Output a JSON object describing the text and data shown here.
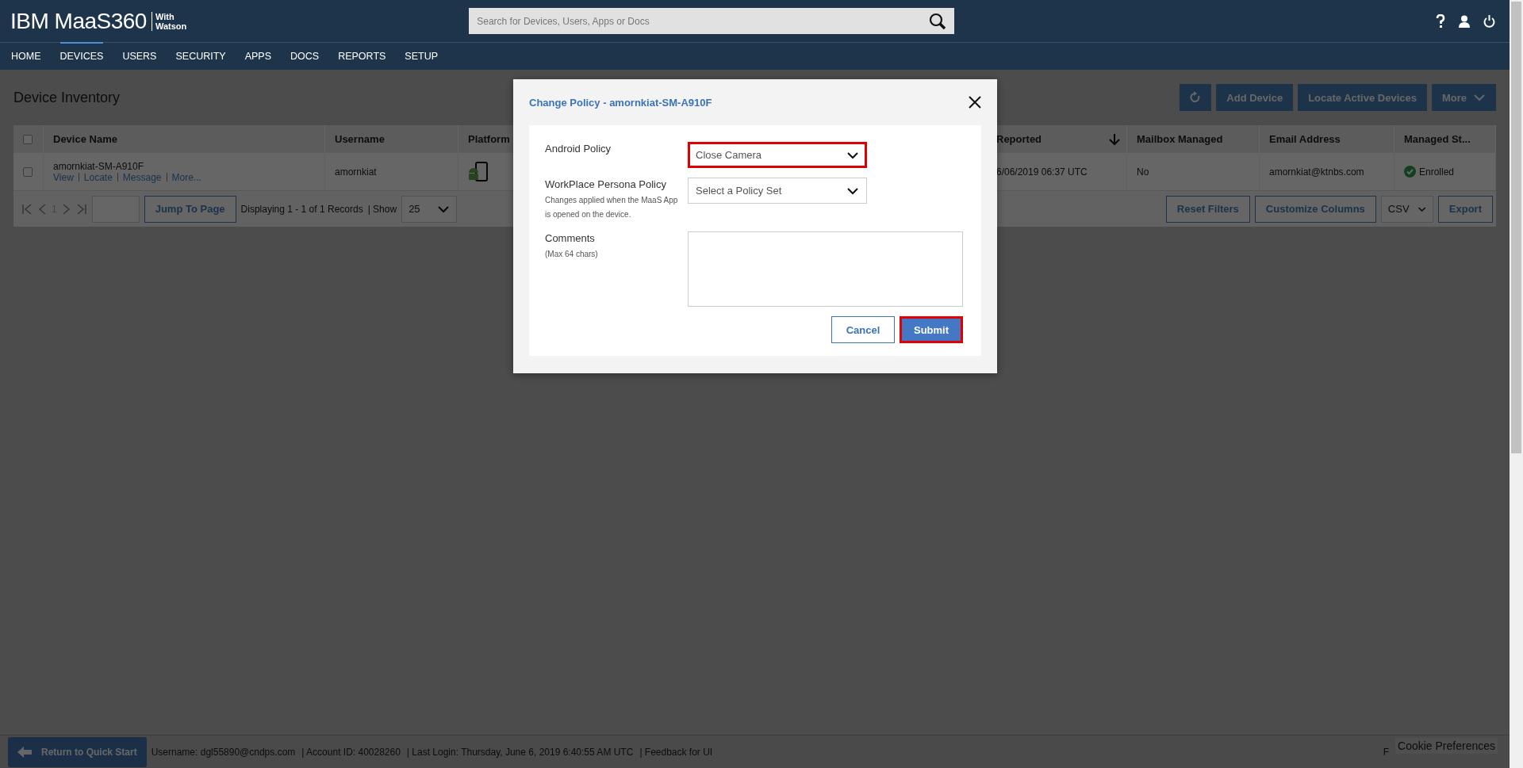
{
  "header": {
    "logo": "IBM MaaS360",
    "logo_suffix": [
      "With",
      "Watson"
    ],
    "search": {
      "placeholder": "Search for Devices, Users, Apps or Docs"
    }
  },
  "nav": [
    {
      "label": "HOME",
      "selected": false
    },
    {
      "label": "DEVICES",
      "selected": true
    },
    {
      "label": "USERS",
      "selected": false
    },
    {
      "label": "SECURITY",
      "selected": false
    },
    {
      "label": "APPS",
      "selected": false
    },
    {
      "label": "DOCS",
      "selected": false
    },
    {
      "label": "REPORTS",
      "selected": false
    },
    {
      "label": "SETUP",
      "selected": false
    }
  ],
  "page": {
    "title": "Device Inventory",
    "actions": [
      {
        "kind": "icon"
      },
      {
        "kind": "text",
        "label": "Add Device"
      },
      {
        "kind": "text",
        "label": "Locate Active Devices"
      },
      {
        "kind": "menu",
        "label": "More"
      }
    ]
  },
  "table": {
    "select_all": {
      "checked": false
    },
    "columns": [
      {
        "label": "Device Name",
        "sorted": false
      },
      {
        "label": "Username",
        "sorted": false
      },
      {
        "label": "Platform",
        "sorted": false
      },
      {
        "label": "Reported",
        "sorted": true
      },
      {
        "label": "Mailbox Managed",
        "sorted": false
      },
      {
        "label": "Email Address",
        "sorted": false
      },
      {
        "label": "Managed St...",
        "sorted": false
      }
    ],
    "rows": [
      {
        "checked": false,
        "device_name": "amornkiat-SM-A910F",
        "links": [
          "View",
          "Locate",
          "Message",
          "More..."
        ],
        "username": "amornkiat",
        "reported": "6/06/2019 06:37 UTC",
        "mailbox_managed": "No",
        "email": "amornkiat@ktnbs.com",
        "status": "Enrolled"
      }
    ]
  },
  "pager": {
    "page": "1",
    "jump_button": "Jump To Page",
    "summary": "Displaying 1 - 1 of 1 Records",
    "show_label": "| Show",
    "page_size": "25",
    "buttons": [
      "Reset Filters",
      "Customize Columns"
    ],
    "format": "CSV",
    "export_button": "Export"
  },
  "dialog": {
    "title": "Change Policy - amornkiat-SM-A910F",
    "fields": [
      {
        "kind": "select",
        "label": "Android Policy",
        "value": "Close Camera",
        "highlighted": true
      },
      {
        "kind": "select",
        "label": "WorkPlace Persona Policy",
        "hint": "Changes applied when the MaaS App is opened on the device.",
        "placeholder": "Select a Policy Set",
        "highlighted": false
      },
      {
        "kind": "textarea",
        "label": "Comments",
        "hint": "(Max 64 chars)"
      }
    ],
    "buttons": [
      {
        "kind": "secondary",
        "label": "Cancel",
        "highlighted": false
      },
      {
        "kind": "primary",
        "label": "Submit",
        "highlighted": true
      }
    ]
  },
  "footer": {
    "return_button": "Return to Quick Start",
    "status": [
      "Username:  dgl55890@cndps.com",
      "| Account ID:  40028260",
      "| Last Login: Thursday, June 6, 2019 6:40:55 AM UTC",
      "| Feedback for UI"
    ],
    "cut_text": "F",
    "cookie_link": "Cookie Preferences"
  }
}
